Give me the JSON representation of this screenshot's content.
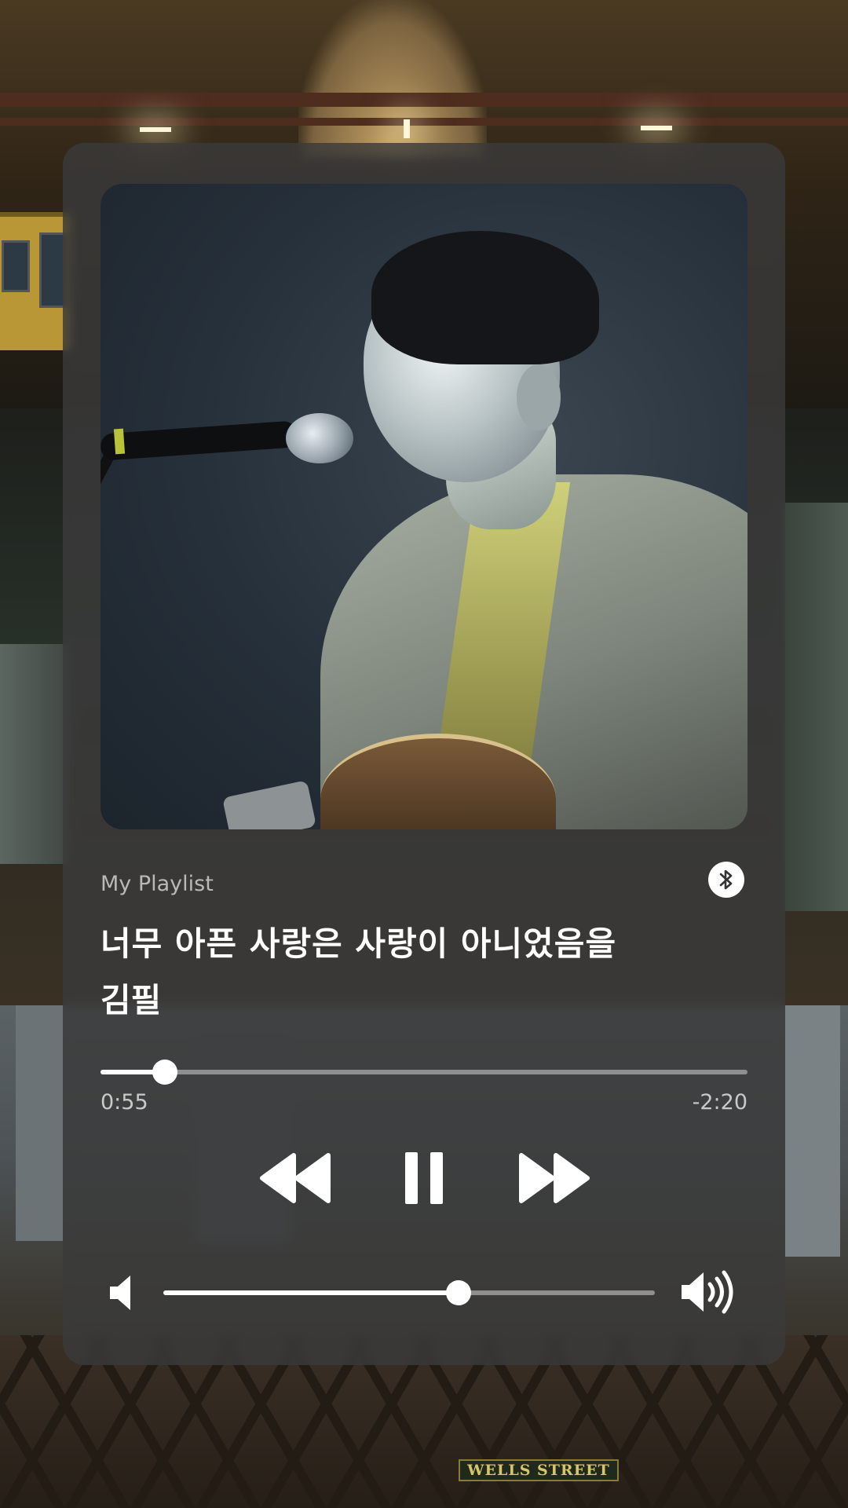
{
  "background": {
    "station_sign": "WELLS STREET"
  },
  "player": {
    "playlist_label": "My Playlist",
    "song_title": "너무 아픈 사랑은 사랑이 아니었음을",
    "artist": "김필",
    "progress": {
      "elapsed": "0:55",
      "remaining": "-2:20",
      "fraction": 0.1
    },
    "volume": {
      "fraction": 0.6
    },
    "controls": {
      "rewind_icon": "rewind-icon",
      "pause_icon": "pause-icon",
      "forward_icon": "fast-forward-icon",
      "bluetooth_icon": "bluetooth-icon",
      "volume_low_icon": "volume-low-icon",
      "volume_high_icon": "volume-high-icon"
    },
    "colors": {
      "card": "#3a3a3a",
      "accent": "#ffffff",
      "secondary_text": "#b9b9b9",
      "track": "#8f8f8f"
    }
  }
}
